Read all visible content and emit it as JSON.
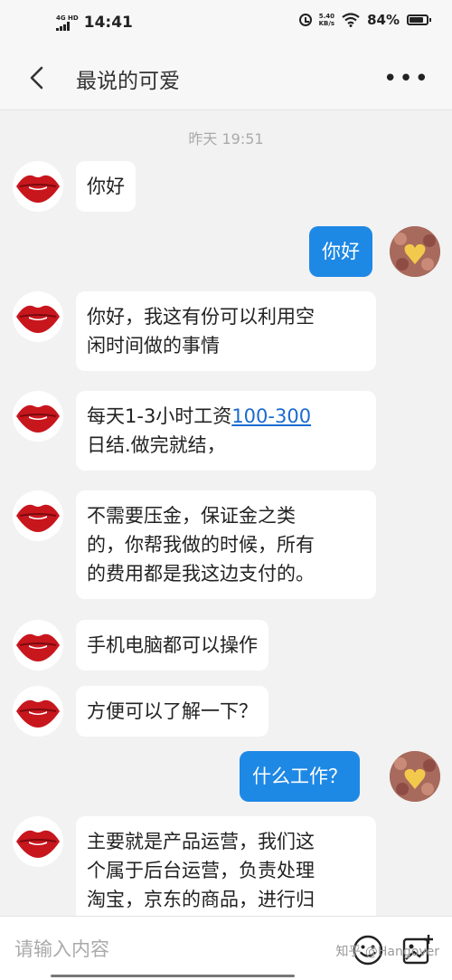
{
  "status_bar": {
    "network": "4G HD",
    "time": "14:41",
    "speed_value": "5.40",
    "speed_unit": "KB/s",
    "battery_percent": "84%",
    "battery_level": 0.84
  },
  "header": {
    "title": "最说的可爱"
  },
  "chat": {
    "timestamp": "昨天 19:51",
    "messages": [
      {
        "side": "left",
        "text": "你好"
      },
      {
        "side": "right",
        "text": "你好"
      },
      {
        "side": "left",
        "lines": [
          "你好，我这有份可以利用空",
          "闲时间做的事情"
        ]
      },
      {
        "side": "left",
        "line1_prefix": "每天1-3小时工资",
        "line1_link": "100-300",
        "line2": "日结.做完就结，"
      },
      {
        "side": "left",
        "lines": [
          "不需要压金，保证金之类",
          "的，你帮我做的时候，所有",
          "的费用都是我这边支付的。"
        ]
      },
      {
        "side": "left",
        "text": "手机电脑都可以操作"
      },
      {
        "side": "left",
        "text": "方便可以了解一下？"
      },
      {
        "side": "right",
        "text": "什么工作？"
      },
      {
        "side": "left",
        "lines": [
          "主要就是产品运营，我们这",
          "个属于后台运营，负责处理",
          "淘宝，京东的商品，进行归"
        ]
      }
    ]
  },
  "input_bar": {
    "placeholder": "请输入内容",
    "watermark": "知乎 @Hangover"
  },
  "colors": {
    "accent": "#1e88e5",
    "background": "#f2f2f2"
  },
  "icons": [
    "back-arrow-icon",
    "more-icon",
    "emoji-icon",
    "image-icon",
    "wifi-icon",
    "alarm-icon",
    "battery-icon",
    "signal-icon"
  ]
}
